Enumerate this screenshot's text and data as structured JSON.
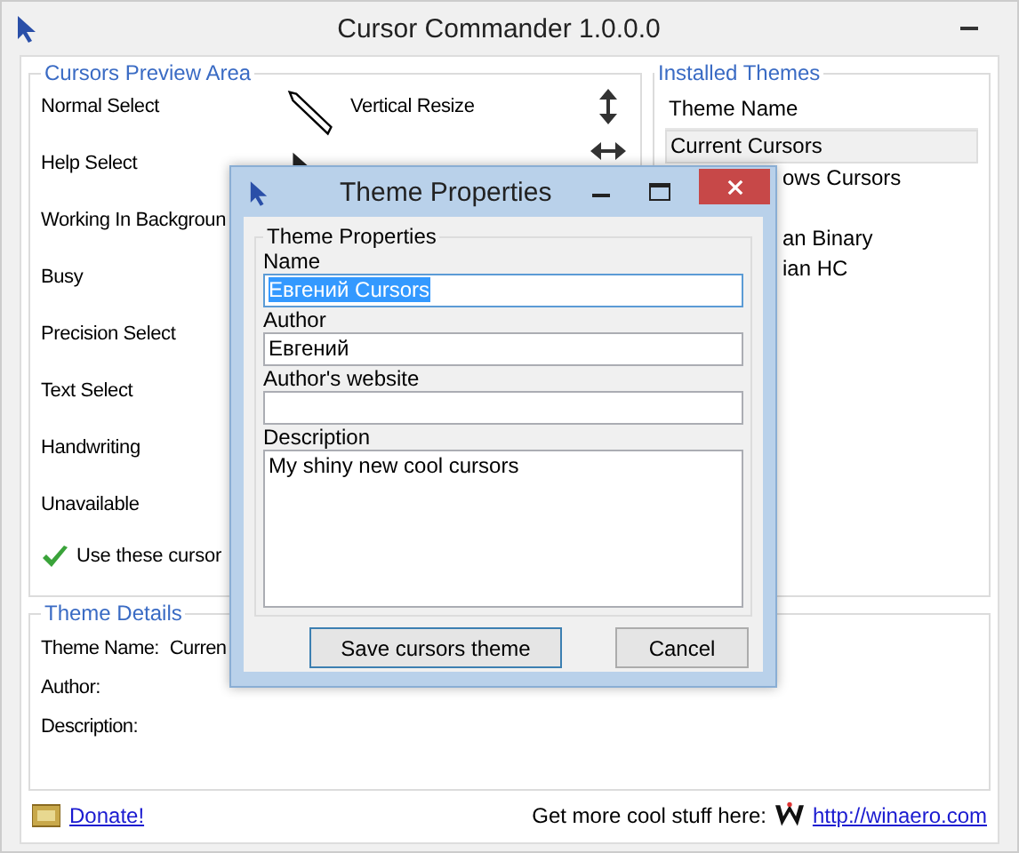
{
  "window": {
    "title": "Cursor Commander 1.0.0.0"
  },
  "preview_area": {
    "title": "Cursors Preview Area",
    "cursors": [
      {
        "label": "Normal Select"
      },
      {
        "label": "Help Select"
      },
      {
        "label": "Working In Backgroun"
      },
      {
        "label": "Busy"
      },
      {
        "label": "Precision Select"
      },
      {
        "label": "Text Select"
      },
      {
        "label": "Handwriting"
      },
      {
        "label": "Unavailable"
      }
    ],
    "second_column": [
      {
        "label": "Vertical Resize"
      }
    ],
    "use_cursors": {
      "label": "Use these cursor",
      "checked": true
    }
  },
  "installed_themes": {
    "title": "Installed Themes",
    "column": "Theme Name",
    "items": [
      {
        "name": "Current Cursors",
        "selected": true,
        "partly_hidden": false
      },
      {
        "name": "ows Cursors",
        "selected": false,
        "partly_hidden": true
      },
      {
        "name": "an Binary",
        "selected": false,
        "partly_hidden": true
      },
      {
        "name": "ian HC",
        "selected": false,
        "partly_hidden": true
      }
    ]
  },
  "theme_details": {
    "title": "Theme Details",
    "rows": [
      {
        "label": "Theme Name:",
        "value": "Curren"
      },
      {
        "label": "Author:"
      },
      {
        "label": "Description:"
      }
    ]
  },
  "footer": {
    "donate": "Donate!",
    "promo": "Get more cool stuff here:",
    "link": "http://winaero.com"
  },
  "dialog": {
    "title": "Theme Properties",
    "group_title": "Theme Properties",
    "fields": [
      {
        "label": "Name",
        "value": "Евгений Cursors",
        "kind": "line",
        "text_selected": true
      },
      {
        "label": "Author",
        "value": "Евгений",
        "kind": "line",
        "text_selected": false
      },
      {
        "label": "Author's website",
        "kind": "line",
        "text_selected": false
      },
      {
        "label": "Description",
        "value": "My shiny new cool cursors",
        "kind": "area",
        "text_selected": false
      }
    ],
    "buttons": [
      {
        "label": "Save cursors theme",
        "default": true
      },
      {
        "label": "Cancel",
        "default": false
      }
    ]
  }
}
